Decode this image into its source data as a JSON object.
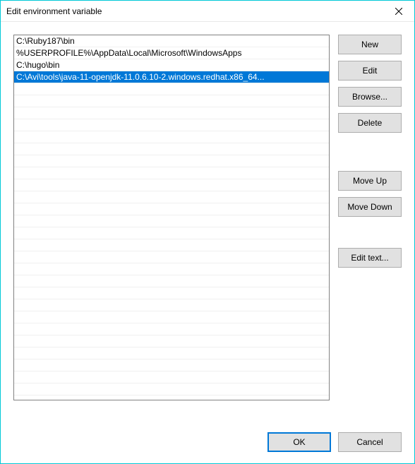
{
  "window": {
    "title": "Edit environment variable"
  },
  "list": {
    "items": [
      {
        "path": "C:\\Ruby187\\bin",
        "selected": false
      },
      {
        "path": "%USERPROFILE%\\AppData\\Local\\Microsoft\\WindowsApps",
        "selected": false
      },
      {
        "path": "C:\\hugo\\bin",
        "selected": false
      },
      {
        "path": "C:\\Avi\\tools\\java-11-openjdk-11.0.6.10-2.windows.redhat.x86_64...",
        "selected": true
      }
    ],
    "visible_rows": 30
  },
  "buttons": {
    "new": "New",
    "edit": "Edit",
    "browse": "Browse...",
    "delete": "Delete",
    "move_up": "Move Up",
    "move_down": "Move Down",
    "edit_text": "Edit text..."
  },
  "footer": {
    "ok": "OK",
    "cancel": "Cancel"
  }
}
